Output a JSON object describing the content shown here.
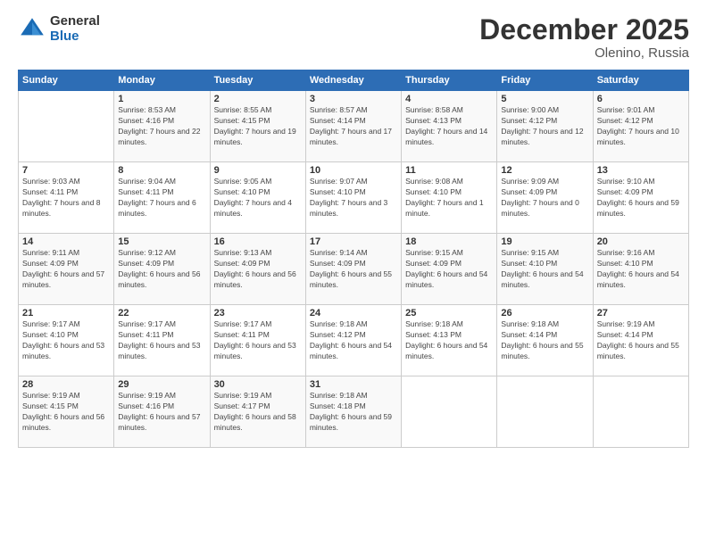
{
  "logo": {
    "general": "General",
    "blue": "Blue"
  },
  "header": {
    "month": "December 2025",
    "location": "Olenino, Russia"
  },
  "weekdays": [
    "Sunday",
    "Monday",
    "Tuesday",
    "Wednesday",
    "Thursday",
    "Friday",
    "Saturday"
  ],
  "weeks": [
    [
      {
        "day": "",
        "sunrise": "",
        "sunset": "",
        "daylight": ""
      },
      {
        "day": "1",
        "sunrise": "Sunrise: 8:53 AM",
        "sunset": "Sunset: 4:16 PM",
        "daylight": "Daylight: 7 hours and 22 minutes."
      },
      {
        "day": "2",
        "sunrise": "Sunrise: 8:55 AM",
        "sunset": "Sunset: 4:15 PM",
        "daylight": "Daylight: 7 hours and 19 minutes."
      },
      {
        "day": "3",
        "sunrise": "Sunrise: 8:57 AM",
        "sunset": "Sunset: 4:14 PM",
        "daylight": "Daylight: 7 hours and 17 minutes."
      },
      {
        "day": "4",
        "sunrise": "Sunrise: 8:58 AM",
        "sunset": "Sunset: 4:13 PM",
        "daylight": "Daylight: 7 hours and 14 minutes."
      },
      {
        "day": "5",
        "sunrise": "Sunrise: 9:00 AM",
        "sunset": "Sunset: 4:12 PM",
        "daylight": "Daylight: 7 hours and 12 minutes."
      },
      {
        "day": "6",
        "sunrise": "Sunrise: 9:01 AM",
        "sunset": "Sunset: 4:12 PM",
        "daylight": "Daylight: 7 hours and 10 minutes."
      }
    ],
    [
      {
        "day": "7",
        "sunrise": "Sunrise: 9:03 AM",
        "sunset": "Sunset: 4:11 PM",
        "daylight": "Daylight: 7 hours and 8 minutes."
      },
      {
        "day": "8",
        "sunrise": "Sunrise: 9:04 AM",
        "sunset": "Sunset: 4:11 PM",
        "daylight": "Daylight: 7 hours and 6 minutes."
      },
      {
        "day": "9",
        "sunrise": "Sunrise: 9:05 AM",
        "sunset": "Sunset: 4:10 PM",
        "daylight": "Daylight: 7 hours and 4 minutes."
      },
      {
        "day": "10",
        "sunrise": "Sunrise: 9:07 AM",
        "sunset": "Sunset: 4:10 PM",
        "daylight": "Daylight: 7 hours and 3 minutes."
      },
      {
        "day": "11",
        "sunrise": "Sunrise: 9:08 AM",
        "sunset": "Sunset: 4:10 PM",
        "daylight": "Daylight: 7 hours and 1 minute."
      },
      {
        "day": "12",
        "sunrise": "Sunrise: 9:09 AM",
        "sunset": "Sunset: 4:09 PM",
        "daylight": "Daylight: 7 hours and 0 minutes."
      },
      {
        "day": "13",
        "sunrise": "Sunrise: 9:10 AM",
        "sunset": "Sunset: 4:09 PM",
        "daylight": "Daylight: 6 hours and 59 minutes."
      }
    ],
    [
      {
        "day": "14",
        "sunrise": "Sunrise: 9:11 AM",
        "sunset": "Sunset: 4:09 PM",
        "daylight": "Daylight: 6 hours and 57 minutes."
      },
      {
        "day": "15",
        "sunrise": "Sunrise: 9:12 AM",
        "sunset": "Sunset: 4:09 PM",
        "daylight": "Daylight: 6 hours and 56 minutes."
      },
      {
        "day": "16",
        "sunrise": "Sunrise: 9:13 AM",
        "sunset": "Sunset: 4:09 PM",
        "daylight": "Daylight: 6 hours and 56 minutes."
      },
      {
        "day": "17",
        "sunrise": "Sunrise: 9:14 AM",
        "sunset": "Sunset: 4:09 PM",
        "daylight": "Daylight: 6 hours and 55 minutes."
      },
      {
        "day": "18",
        "sunrise": "Sunrise: 9:15 AM",
        "sunset": "Sunset: 4:09 PM",
        "daylight": "Daylight: 6 hours and 54 minutes."
      },
      {
        "day": "19",
        "sunrise": "Sunrise: 9:15 AM",
        "sunset": "Sunset: 4:10 PM",
        "daylight": "Daylight: 6 hours and 54 minutes."
      },
      {
        "day": "20",
        "sunrise": "Sunrise: 9:16 AM",
        "sunset": "Sunset: 4:10 PM",
        "daylight": "Daylight: 6 hours and 54 minutes."
      }
    ],
    [
      {
        "day": "21",
        "sunrise": "Sunrise: 9:17 AM",
        "sunset": "Sunset: 4:10 PM",
        "daylight": "Daylight: 6 hours and 53 minutes."
      },
      {
        "day": "22",
        "sunrise": "Sunrise: 9:17 AM",
        "sunset": "Sunset: 4:11 PM",
        "daylight": "Daylight: 6 hours and 53 minutes."
      },
      {
        "day": "23",
        "sunrise": "Sunrise: 9:17 AM",
        "sunset": "Sunset: 4:11 PM",
        "daylight": "Daylight: 6 hours and 53 minutes."
      },
      {
        "day": "24",
        "sunrise": "Sunrise: 9:18 AM",
        "sunset": "Sunset: 4:12 PM",
        "daylight": "Daylight: 6 hours and 54 minutes."
      },
      {
        "day": "25",
        "sunrise": "Sunrise: 9:18 AM",
        "sunset": "Sunset: 4:13 PM",
        "daylight": "Daylight: 6 hours and 54 minutes."
      },
      {
        "day": "26",
        "sunrise": "Sunrise: 9:18 AM",
        "sunset": "Sunset: 4:14 PM",
        "daylight": "Daylight: 6 hours and 55 minutes."
      },
      {
        "day": "27",
        "sunrise": "Sunrise: 9:19 AM",
        "sunset": "Sunset: 4:14 PM",
        "daylight": "Daylight: 6 hours and 55 minutes."
      }
    ],
    [
      {
        "day": "28",
        "sunrise": "Sunrise: 9:19 AM",
        "sunset": "Sunset: 4:15 PM",
        "daylight": "Daylight: 6 hours and 56 minutes."
      },
      {
        "day": "29",
        "sunrise": "Sunrise: 9:19 AM",
        "sunset": "Sunset: 4:16 PM",
        "daylight": "Daylight: 6 hours and 57 minutes."
      },
      {
        "day": "30",
        "sunrise": "Sunrise: 9:19 AM",
        "sunset": "Sunset: 4:17 PM",
        "daylight": "Daylight: 6 hours and 58 minutes."
      },
      {
        "day": "31",
        "sunrise": "Sunrise: 9:18 AM",
        "sunset": "Sunset: 4:18 PM",
        "daylight": "Daylight: 6 hours and 59 minutes."
      },
      {
        "day": "",
        "sunrise": "",
        "sunset": "",
        "daylight": ""
      },
      {
        "day": "",
        "sunrise": "",
        "sunset": "",
        "daylight": ""
      },
      {
        "day": "",
        "sunrise": "",
        "sunset": "",
        "daylight": ""
      }
    ]
  ]
}
